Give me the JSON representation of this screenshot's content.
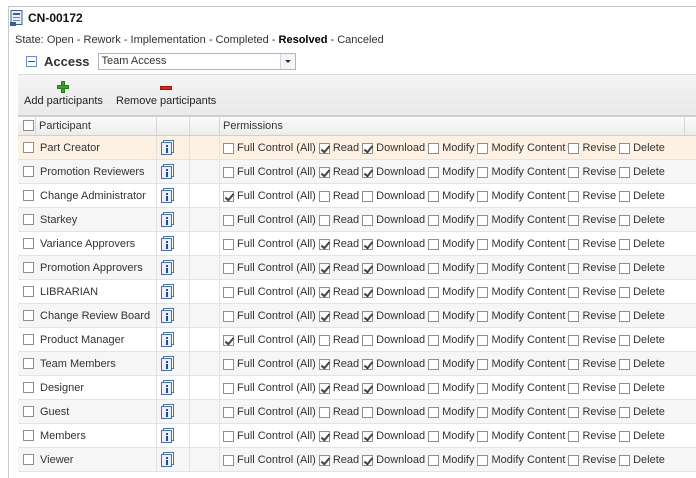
{
  "header": {
    "title": "CN-00172",
    "icon": "change-notice-icon"
  },
  "state": {
    "prefix": "State:",
    "before": "Open - Rework - Implementation - Completed -",
    "current": "Resolved",
    "after": "- Canceled"
  },
  "access": {
    "label": "Access",
    "dropdown_value": "Team Access"
  },
  "toolbar": {
    "add_label": "Add participants",
    "remove_label": "Remove participants"
  },
  "grid": {
    "col_participant": "Participant",
    "col_permissions": "Permissions",
    "perm_labels": [
      "Full Control (All)",
      "Read",
      "Download",
      "Modify",
      "Modify Content",
      "Revise",
      "Delete"
    ],
    "rows": [
      {
        "name": "Part Creator",
        "perms": [
          false,
          true,
          true,
          false,
          false,
          false,
          false
        ],
        "selected": true
      },
      {
        "name": "Promotion Reviewers",
        "perms": [
          false,
          true,
          true,
          false,
          false,
          false,
          false
        ]
      },
      {
        "name": "Change Administrator",
        "perms": [
          true,
          false,
          false,
          false,
          false,
          false,
          false
        ]
      },
      {
        "name": "Starkey",
        "perms": [
          false,
          false,
          false,
          false,
          false,
          false,
          false
        ]
      },
      {
        "name": "Variance Approvers",
        "perms": [
          false,
          true,
          true,
          false,
          false,
          false,
          false
        ]
      },
      {
        "name": "Promotion Approvers",
        "perms": [
          false,
          true,
          true,
          false,
          false,
          false,
          false
        ]
      },
      {
        "name": "LIBRARIAN",
        "perms": [
          false,
          true,
          true,
          false,
          false,
          false,
          false
        ]
      },
      {
        "name": "Change Review Board",
        "perms": [
          false,
          true,
          true,
          false,
          false,
          false,
          false
        ]
      },
      {
        "name": "Product Manager",
        "perms": [
          true,
          false,
          false,
          false,
          false,
          false,
          false
        ]
      },
      {
        "name": "Team Members",
        "perms": [
          false,
          true,
          true,
          false,
          false,
          false,
          false
        ]
      },
      {
        "name": "Designer",
        "perms": [
          false,
          true,
          true,
          false,
          false,
          false,
          false
        ]
      },
      {
        "name": "Guest",
        "perms": [
          false,
          false,
          false,
          false,
          false,
          false,
          false
        ]
      },
      {
        "name": "Members",
        "perms": [
          false,
          true,
          true,
          false,
          false,
          false,
          false
        ]
      },
      {
        "name": "Viewer",
        "perms": [
          false,
          true,
          true,
          false,
          false,
          false,
          false
        ]
      }
    ]
  },
  "colors": {
    "selected_row": "#fdf1e4",
    "add_icon": "#3aa52a",
    "remove_icon": "#d42323"
  }
}
